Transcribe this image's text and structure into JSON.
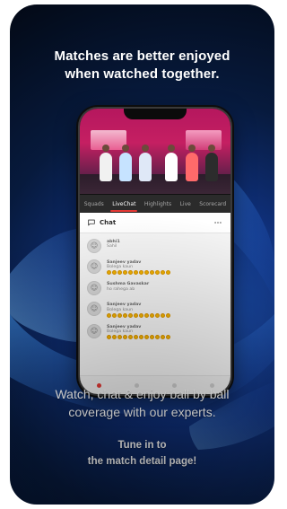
{
  "headline": {
    "line1": "Matches are better enjoyed",
    "line2": "when watched together."
  },
  "phone": {
    "tabs": [
      "Squads",
      "LiveChat",
      "Highlights",
      "Live",
      "Scorecard"
    ],
    "active_tab_index": 1,
    "chat": {
      "title": "Chat",
      "messages": [
        {
          "name": "abhi1",
          "text": "Sahil",
          "emoji_count": 0
        },
        {
          "name": "Sanjeev yadav",
          "text": "Bolega kaun",
          "emoji_count": 12
        },
        {
          "name": "Sushma Gavaskar",
          "text": "ho rahega ab",
          "emoji_count": 0
        },
        {
          "name": "Sanjeev yadav",
          "text": "Bolega kaun",
          "emoji_count": 12
        },
        {
          "name": "Sanjeev yadav",
          "text": "Bolega kaun",
          "emoji_count": 12
        }
      ]
    }
  },
  "subtext": {
    "line1": "Watch, chat & enjoy ball by ball",
    "line2": "coverage with our experts."
  },
  "cta": {
    "line1": "Tune in to",
    "line2": "the match detail page!"
  },
  "colors": {
    "card_bg_dark": "#030915",
    "card_bg_light": "#1f56b8",
    "tab_active_underline": "#e53935",
    "chat_bg": "#f6f6f6"
  },
  "icons": {
    "chat": "chat-bubble-icon",
    "more": "more-icon",
    "avatar": "avatar-icon",
    "emoji": "emoji-icon"
  }
}
